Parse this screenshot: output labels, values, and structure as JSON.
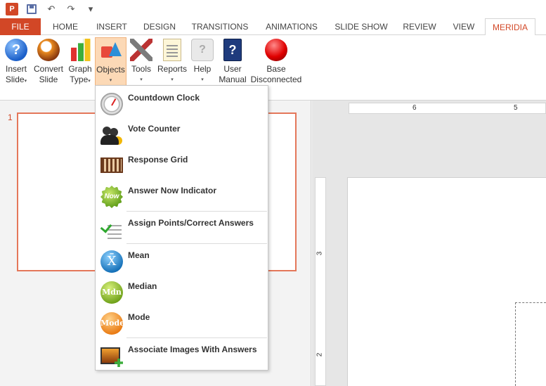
{
  "quick_access": {
    "app_icon_label": "P",
    "undo": "↶",
    "redo": "↷",
    "customize": "▾"
  },
  "tabs": [
    {
      "label": "FILE"
    },
    {
      "label": "HOME"
    },
    {
      "label": "INSERT"
    },
    {
      "label": "DESIGN"
    },
    {
      "label": "TRANSITIONS"
    },
    {
      "label": "ANIMATIONS"
    },
    {
      "label": "SLIDE SHOW"
    },
    {
      "label": "REVIEW"
    },
    {
      "label": "VIEW"
    },
    {
      "label": "MERIDIA"
    }
  ],
  "active_tab": "MERIDIA",
  "ribbon": {
    "insert_slide": {
      "line1": "Insert",
      "line2": "Slide",
      "caret": "▾",
      "icon": "question-icon",
      "glyph": "?"
    },
    "convert_slide": {
      "line1": "Convert",
      "line2": "Slide",
      "icon": "convert-icon"
    },
    "graph_type": {
      "line1": "Graph",
      "line2": "Type",
      "caret": "▾",
      "icon": "graph-icon"
    },
    "objects": {
      "line1": "Objects",
      "caret": "▾",
      "icon": "shapes-icon"
    },
    "tools": {
      "line1": "Tools",
      "caret": "▾",
      "icon": "tools-icon"
    },
    "reports": {
      "line1": "Reports",
      "caret": "▾",
      "icon": "report-icon"
    },
    "help": {
      "line1": "Help",
      "caret": "▾",
      "icon": "help-bubble-icon",
      "glyph": "?"
    },
    "user_manual": {
      "line1": "User",
      "line2": "Manual",
      "icon": "manual-icon",
      "glyph": "?"
    },
    "base": {
      "line1": "Base",
      "line2": "Disconnected",
      "icon": "status-red-icon"
    }
  },
  "slides_pane": {
    "slide_number": "1"
  },
  "rulers": {
    "h_marks": [
      "6",
      "5"
    ],
    "v_marks": [
      "3",
      "2"
    ]
  },
  "objects_menu": {
    "items": [
      {
        "label": "Countdown Clock",
        "icon": "stopwatch-icon"
      },
      {
        "label": "Vote Counter",
        "icon": "people-icon"
      },
      {
        "label": "Response Grid",
        "icon": "grid-icon"
      },
      {
        "label": "Answer Now Indicator",
        "icon": "now-badge-icon",
        "glyph": "Now"
      },
      {
        "label": "Assign Points/Correct Answers",
        "icon": "checklist-icon"
      },
      {
        "label": "Mean",
        "icon": "mean-icon",
        "glyph": "X̄"
      },
      {
        "label": "Median",
        "icon": "median-icon",
        "glyph": "Mdn"
      },
      {
        "label": "Mode",
        "icon": "mode-icon",
        "glyph": "Mode"
      },
      {
        "label": "Associate Images With Answers",
        "icon": "image-add-icon"
      }
    ]
  },
  "colors": {
    "accent": "#d24726",
    "selected_button_bg": "#fcd9b6",
    "slide_border": "#e4775a"
  }
}
